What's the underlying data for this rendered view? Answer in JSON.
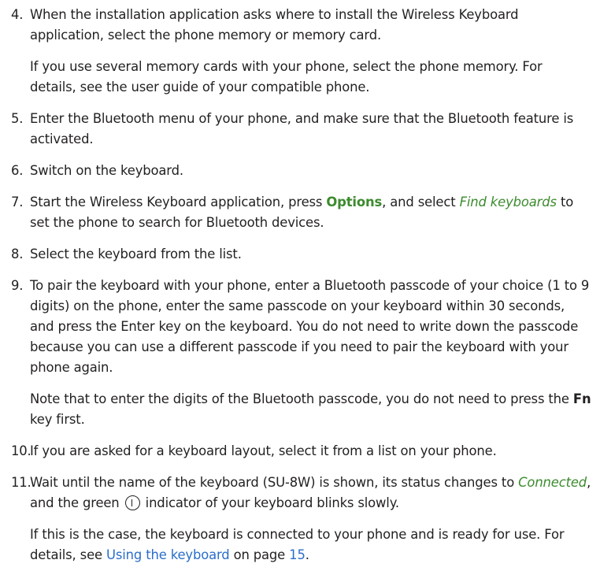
{
  "steps": {
    "s4": {
      "num": "4.",
      "text": "When the installation application asks where to install the Wireless Keyboard application, select the phone memory or memory card.",
      "note": "If you use several memory cards with your phone, select the phone memory. For details, see the user guide of your compatible phone."
    },
    "s5": {
      "num": "5.",
      "text": "Enter the Bluetooth menu of your phone, and make sure that the Bluetooth feature is activated."
    },
    "s6": {
      "num": "6.",
      "text": "Switch on the keyboard."
    },
    "s7": {
      "num": "7.",
      "pre": "Start the Wireless Keyboard application, press ",
      "options": "Options",
      "mid": ", and select ",
      "find": "Find keyboards",
      "post": " to set the phone to search for Bluetooth devices."
    },
    "s8": {
      "num": "8.",
      "text": "Select the keyboard from the list."
    },
    "s9": {
      "num": "9.",
      "text": "To pair the keyboard with your phone, enter a Bluetooth passcode of your choice (1 to 9 digits) on the phone, enter the same passcode on your keyboard within 30 seconds, and press the Enter key on the keyboard. You do not need to write down the passcode because you can use a different passcode if you need to pair the keyboard with your phone again.",
      "note_pre": "Note that to enter the digits of the Bluetooth passcode, you do not need to press the ",
      "note_key": "Fn",
      "note_post": " key first."
    },
    "s10": {
      "num": "10.",
      "text": "If you are asked for a keyboard layout, select it from a list on your phone."
    },
    "s11": {
      "num": "11.",
      "pre": "Wait until the name of the keyboard (SU-8W) is shown, its status changes to ",
      "connected": "Connected",
      "mid": ", and the green ",
      "post": " indicator of your keyboard blinks slowly.",
      "note_pre": "If this is the case, the keyboard is connected to your phone and is ready for use. For details, see ",
      "note_link": "Using the keyboard",
      "note_mid": " on page ",
      "note_page": "15",
      "note_post": "."
    }
  },
  "colors": {
    "text": "#231f20",
    "ui_green": "#3c8b2e",
    "link_blue": "#2a6ec9"
  },
  "icons": {
    "power_indicator": "power-indicator-icon"
  }
}
